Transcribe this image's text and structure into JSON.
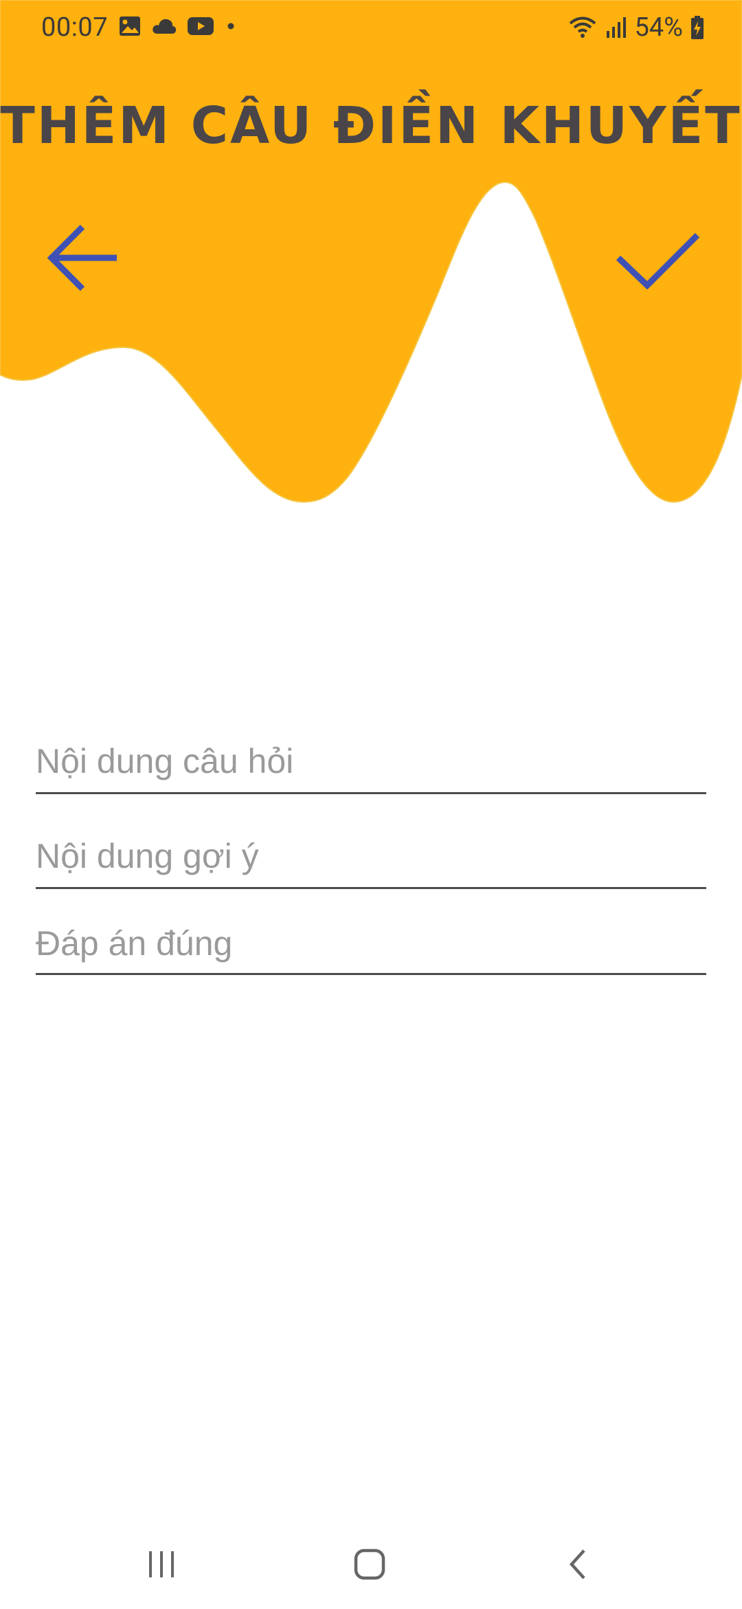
{
  "status_bar": {
    "time": "00:07",
    "battery": "54%",
    "left_icons": [
      "gallery-icon",
      "cloud-icon",
      "youtube-icon",
      "dot-icon"
    ],
    "right_icons": [
      "wifi-icon",
      "signal-icon",
      "battery-charging-icon"
    ]
  },
  "header": {
    "title": "THÊM CÂU ĐIỀN KHUYẾT",
    "background_color": "#FFB10F",
    "back_icon": "arrow-left-icon",
    "confirm_icon": "checkmark-icon",
    "icon_color": "#3F51B5"
  },
  "form": {
    "question": {
      "placeholder": "Nội dung câu hỏi",
      "value": ""
    },
    "hint": {
      "placeholder": "Nội dung gợi ý",
      "value": ""
    },
    "answer": {
      "placeholder": "Đáp án đúng",
      "value": ""
    }
  },
  "navigation": {
    "icons": [
      "recents-icon",
      "home-icon",
      "back-chevron-icon"
    ]
  }
}
